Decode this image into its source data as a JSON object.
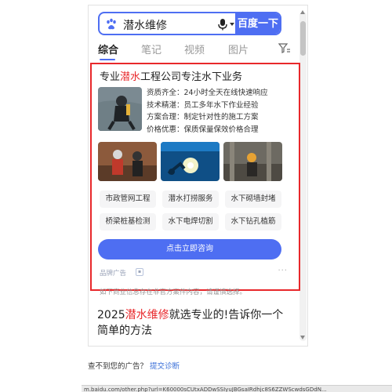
{
  "search": {
    "query": "潜水维修",
    "button_label": "百度一下"
  },
  "tabs": [
    "综合",
    "笔记",
    "视频",
    "图片"
  ],
  "ad": {
    "title_prefix": "专业",
    "title_highlight": "潜水",
    "title_suffix": "工程公司专注水下业务",
    "features": [
      "资质齐全：24小时全天在线快速响应",
      "技术精湛：员工多年水下作业经验",
      "方案合理：制定针对性的施工方案",
      "价格优惠：保质保量保效价格合理"
    ],
    "tags": [
      "市政管网工程",
      "潜水打捞服务",
      "水下砌墙封堵",
      "桥梁桩基检测",
      "水下电焊切割",
      "水下钻孔植筋"
    ],
    "cta_label": "点击立即咨询",
    "brand_label": "品牌广告"
  },
  "disclaimer": "如下商业信息存在非官方案件内容，请谨慎选择。",
  "result2": {
    "prefix": "2025",
    "highlight": "潜水维修",
    "suffix": "就选专业的!告诉你一个简单的方法"
  },
  "below": {
    "text": "查不到您的广告？",
    "link": "提交诊断"
  },
  "statusbar_url": "m.baidu.com/other.php?url=K60000sCUtxADDwSSIyuJBGsaIRdhjc8S6ZZWScwdsGDdN..."
}
